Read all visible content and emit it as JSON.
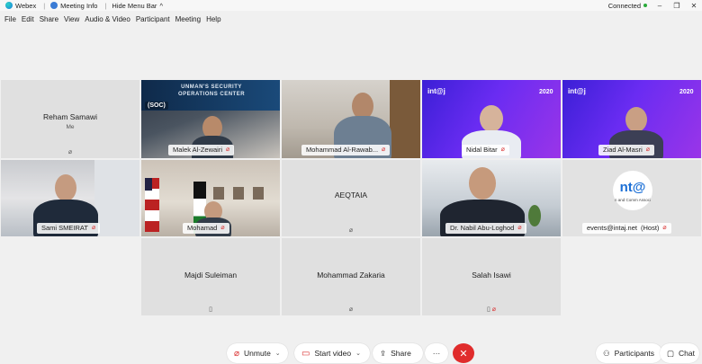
{
  "titlebar": {
    "app_name": "Webex",
    "meeting_info": "Meeting Info",
    "hide_menu": "Hide Menu Bar",
    "hide_menu_caret": "^",
    "status": "Connected",
    "minimize": "–",
    "restore": "❐",
    "close": "✕"
  },
  "menu": [
    "File",
    "Edit",
    "Share",
    "View",
    "Audio & Video",
    "Participant",
    "Meeting",
    "Help"
  ],
  "participants": {
    "reham": {
      "name": "Reham Samawi",
      "sub": "Me"
    },
    "malek": {
      "name": "Malek Al-Zewairi"
    },
    "mohammad_rawab": {
      "name": "Mohammad Al-Rawab..."
    },
    "nidal": {
      "name": "Nidal Bitar"
    },
    "ziad": {
      "name": "Ziad Al-Masri"
    },
    "sami": {
      "name": "Sami SMEIRAT"
    },
    "mohamad": {
      "name": "Mohamad"
    },
    "aeqtaia": {
      "name": "AEQTAIA"
    },
    "nabil": {
      "name": "Dr. Nabil Abu-Loghod"
    },
    "events": {
      "name": "events@intaj.net",
      "role": "(Host)",
      "logo_text": "nt@",
      "logo_sub": "n and Comm Associ"
    },
    "majdi": {
      "name": "Majdi Suleiman"
    },
    "mohammad_zakaria": {
      "name": "Mohammad Zakaria"
    },
    "salah": {
      "name": "Salah Isawi"
    }
  },
  "soc_banner": {
    "line1": "UNMAN'S SECURITY",
    "line2": "OPERATIONS CENTER",
    "tag": "(SOC)"
  },
  "intaj_banner": {
    "brand": "int@j",
    "year": "2020"
  },
  "toolbar": {
    "unmute": "Unmute",
    "start_video": "Start video",
    "share": "Share",
    "more": "···",
    "end": "✕",
    "participants": "Participants",
    "chat": "Chat"
  },
  "icons": {
    "mic_muted": "mic-muted-icon",
    "video": "video-icon",
    "share": "share-icon",
    "participants": "participants-icon",
    "chat": "chat-icon",
    "phone": "phone-icon"
  },
  "colors": {
    "mute_red": "#d92b2b",
    "end_red": "#e02c2c",
    "connected_green": "#2aaa3a"
  }
}
